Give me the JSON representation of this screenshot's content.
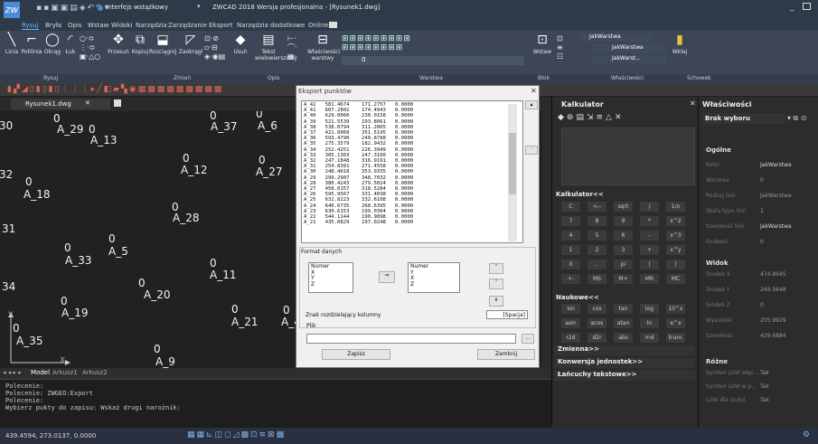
{
  "app": {
    "qat_title": "Interfejs wstążkowy",
    "window_title": "ZWCAD 2018 Wersja profesjonalna - [Rysunek1.dwg]"
  },
  "ribbon_tabs": [
    "Rysuj",
    "Bryła",
    "Opis",
    "Wstaw",
    "Widoki",
    "Narzędzia",
    "Zarządzanie",
    "Eksport",
    "Narzędzia dodatkowe",
    "Online"
  ],
  "ribbon": {
    "draw_buttons": [
      "Linia",
      "Polilinia",
      "Okrąg",
      "Łuk"
    ],
    "modify_buttons": [
      "Przesuń",
      "Kopiuj",
      "Rozciągnij",
      "Zaokrągl"
    ],
    "erase": "Usuń",
    "text": "Tekst wielowierszowy",
    "props": "Właściwości warstwy",
    "layer_value": "0",
    "insert": "Wstaw",
    "paste": "Wklej",
    "layer_dropdowns": [
      "JakWarstwa",
      "JakWarstwa",
      "JakWarst..."
    ]
  },
  "group_labels": [
    "Rysuj",
    "Zmień",
    "Opis",
    "Warstwa",
    "Blok",
    "Właściwości",
    "Schowek"
  ],
  "doc_tab": "Rysunek1.dwg",
  "points": [
    {
      "num": "30",
      "label": ""
    },
    {
      "num": "0",
      "label": "A_29"
    },
    {
      "num": "0",
      "label": "A_13"
    },
    {
      "num": "0",
      "label": "A_37"
    },
    {
      "num": "0",
      "label": "A_6"
    },
    {
      "num": "32",
      "label": ""
    },
    {
      "num": "0",
      "label": "A_12"
    },
    {
      "num": "0",
      "label": "A_27"
    },
    {
      "num": "0",
      "label": "A_18"
    },
    {
      "num": "0",
      "label": "A_28"
    },
    {
      "num": "31",
      "label": ""
    },
    {
      "num": "0",
      "label": "A_33"
    },
    {
      "num": "0",
      "label": "A_5"
    },
    {
      "num": "0",
      "label": "A_11"
    },
    {
      "num": "34",
      "label": ""
    },
    {
      "num": "0",
      "label": "A_20"
    },
    {
      "num": "0",
      "label": "A_19"
    },
    {
      "num": "0",
      "label": "A_21"
    },
    {
      "num": "0",
      "label": "A_4"
    },
    {
      "num": "0",
      "label": "A_35"
    },
    {
      "num": "0",
      "label": "A_9"
    }
  ],
  "axis": {
    "x": "X",
    "y": "Y"
  },
  "layout_tabs": [
    "Model",
    "Arkusz1",
    "Arkusz2"
  ],
  "console_lines": [
    "Polecenie:",
    "Polecenie: ZWGEO:Export",
    "Polecenie:",
    "Wybierz pukty do zapisu: Wskaż drugi narożnik:"
  ],
  "status_coords": "439.4594, 273.0137, 0.0000",
  "dialog": {
    "title": "Eksport punktów",
    "rows": [
      [
        "A_42",
        "581.4674",
        "171.2757",
        "0.0000"
      ],
      [
        "A_41",
        "607.2802",
        "174.4943",
        "0.0000"
      ],
      [
        "A_40",
        "629.0060",
        "230.0158",
        "0.0000"
      ],
      [
        "A_39",
        "521.5539",
        "193.8061",
        "0.0000"
      ],
      [
        "A_38",
        "538.0794",
        "311.2865",
        "0.0000"
      ],
      [
        "A_37",
        "421.0060",
        "351.5195",
        "0.0000"
      ],
      [
        "A_36",
        "593.4790",
        "240.8788",
        "0.0000"
      ],
      [
        "A_35",
        "275.3579",
        "182.9432",
        "0.0000"
      ],
      [
        "A_34",
        "252.4251",
        "226.3949",
        "0.0000"
      ],
      [
        "A_33",
        "305.1303",
        "247.3160",
        "0.0000"
      ],
      [
        "A_32",
        "247.1848",
        "316.9191",
        "0.0000"
      ],
      [
        "A_31",
        "254.8391",
        "271.4558",
        "0.0000"
      ],
      [
        "A_30",
        "248.4018",
        "353.9335",
        "0.0000"
      ],
      [
        "A_29",
        "299.2907",
        "348.7032",
        "0.0000"
      ],
      [
        "A_28",
        "380.4243",
        "279.5024",
        "0.0000"
      ],
      [
        "A_27",
        "458.0157",
        "318.5284",
        "0.0000"
      ],
      [
        "A_26",
        "595.9567",
        "331.4038",
        "0.0000"
      ],
      [
        "A_25",
        "631.8223",
        "332.6108",
        "0.0000"
      ],
      [
        "A_24",
        "640.6735",
        "268.6395",
        "0.0000"
      ],
      [
        "A_23",
        "630.6153",
        "199.0364",
        "0.0000"
      ],
      [
        "A_22",
        "544.1144",
        "190.9898",
        "0.0000"
      ],
      [
        "A_21",
        "435.0829",
        "197.0248",
        "0.0000"
      ]
    ],
    "format_label": "Format danych",
    "left_list": [
      "Numer",
      "X",
      "Y",
      "Z"
    ],
    "right_list": [
      "Numer",
      "Y",
      "X",
      "Z"
    ],
    "separator_label": "Znak rozdzielający kolumny",
    "separator_value": "[Spacja]",
    "file_label": "Plik",
    "file_value": "",
    "browse": "...",
    "save": "Zapisz",
    "close": "Zamknij"
  },
  "calculator": {
    "title": "Kalkulator",
    "sub_title": "Kalkulator<<",
    "buttons": [
      "C",
      "<--",
      "sqrt",
      "/",
      "1/x",
      "7",
      "8",
      "9",
      "*",
      "x^2",
      "4",
      "5",
      "6",
      "-",
      "x^3",
      "1",
      "2",
      "3",
      "+",
      "x^y",
      "0",
      ".",
      "pi",
      "(",
      ")",
      "+-",
      "MS",
      "M+",
      "MR",
      "MC"
    ],
    "sci_title": "Naukowe<<",
    "sci_buttons": [
      "sin",
      "cos",
      "tan",
      "log",
      "10^x",
      "asin",
      "acos",
      "atan",
      "ln",
      "e^x",
      "r2d",
      "d2r",
      "abs",
      "rnd",
      "trunc"
    ],
    "vars": "Zmienna>>",
    "units": "Konwersja jednostek>>",
    "strings": "Łańcuchy tekstowe>>"
  },
  "properties": {
    "title": "Właściwości",
    "selection": "Brak wyboru",
    "general": "Ogólne",
    "general_rows": [
      {
        "k": "Kolor",
        "v": "JakWarstwa"
      },
      {
        "k": "Warstwa",
        "v": "0"
      },
      {
        "k": "Rodzaj linii",
        "v": "JakWarstwa"
      },
      {
        "k": "Skala typu linii",
        "v": "1"
      },
      {
        "k": "Szerokość linii",
        "v": "JakWarstwa"
      },
      {
        "k": "Grubość",
        "v": "0"
      }
    ],
    "view": "Widok",
    "view_rows": [
      {
        "k": "Środek X",
        "v": "474.8645"
      },
      {
        "k": "Środek Y",
        "v": "264.5648"
      },
      {
        "k": "Środek Z",
        "v": "0"
      },
      {
        "k": "Wysokość",
        "v": "205.9929"
      },
      {
        "k": "Szerokość",
        "v": "429.6884"
      }
    ],
    "misc": "Różne",
    "misc_rows": [
      {
        "k": "Symbol LUW włąc...",
        "v": "Tak"
      },
      {
        "k": "Symbol LUW w p...",
        "v": "Tak"
      },
      {
        "k": "LUW dla rzutni",
        "v": "Tak"
      }
    ]
  },
  "colors": {
    "accent": "#6cb6ff",
    "ribbon": "#3c4657",
    "canvas": "#212121"
  }
}
